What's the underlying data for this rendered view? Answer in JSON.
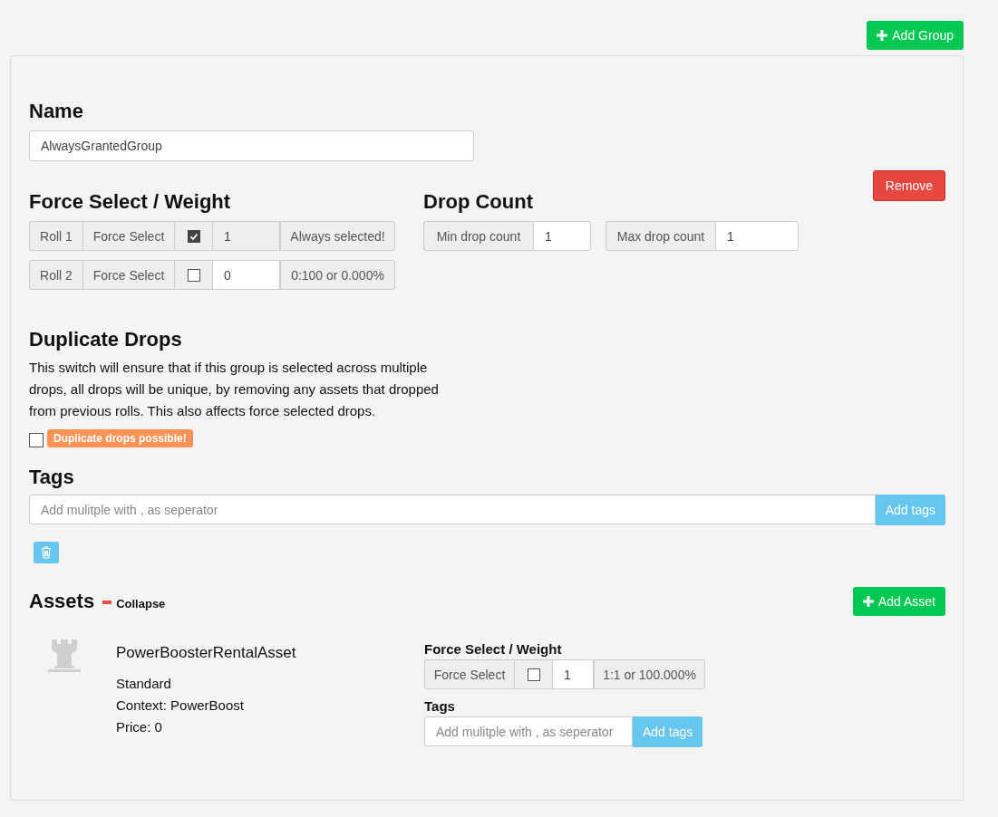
{
  "add_group_button": "Add Group",
  "group": {
    "name_heading": "Name",
    "name_value": "AlwaysGrantedGroup",
    "remove_button": "Remove",
    "weight_heading": "Force Select / Weight",
    "rolls": [
      {
        "roll": "Roll 1",
        "force_label": "Force Select",
        "checked": true,
        "weight": "1",
        "disabled": true,
        "note": "Always selected!"
      },
      {
        "roll": "Roll 2",
        "force_label": "Force Select",
        "checked": false,
        "weight": "0",
        "disabled": false,
        "note": "0:100 or 0.000%"
      }
    ],
    "drop_count_heading": "Drop Count",
    "drop_counts": [
      {
        "label": "Min drop count",
        "value": "1"
      },
      {
        "label": "Max drop count",
        "value": "1"
      }
    ],
    "duplicate_heading": "Duplicate Drops",
    "duplicate_text": "This switch will ensure that if this group is selected across multiple drops, all drops will be unique, by removing any assets that dropped from previous rolls. This also affects force selected drops.",
    "duplicates_unique": false,
    "duplicate_badge": "Duplicate drops possible!",
    "tags_heading": "Tags",
    "tags_placeholder": "Add mulitple with , as seperator",
    "add_tags_button": "Add tags",
    "assets_heading": "Assets",
    "collapse_link": "Collapse",
    "add_asset_button": "Add Asset",
    "assets": [
      {
        "name": "PowerBoosterRentalAsset",
        "details": [
          "Standard",
          "Context: PowerBoost",
          "Price: 0"
        ],
        "weight_heading": "Force Select / Weight",
        "force_label": "Force Select",
        "checked": false,
        "weight": "1",
        "note": "1:1 or 100.000%",
        "tags_heading": "Tags",
        "tags_placeholder": "Add mulitple with , as seperator",
        "add_tags_button": "Add tags"
      }
    ]
  }
}
